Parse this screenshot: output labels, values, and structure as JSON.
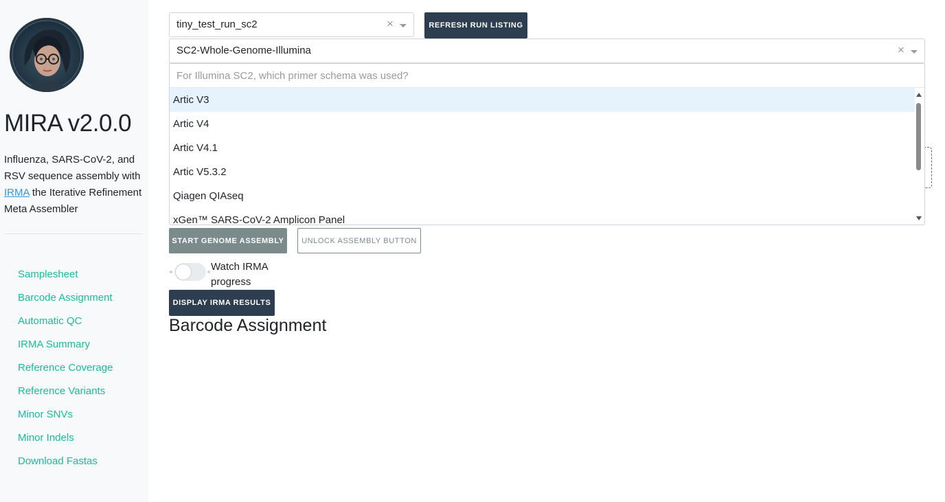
{
  "sidebar": {
    "title": "MIRA v2.0.0",
    "description_before": "Influenza, SARS-CoV-2, and RSV sequence assembly with ",
    "description_link": "IRMA",
    "description_after": " the Iterative Refinement Meta Assembler",
    "nav": [
      "Samplesheet",
      "Barcode Assignment",
      "Automatic QC",
      "IRMA Summary",
      "Reference Coverage",
      "Reference Variants",
      "Minor SNVs",
      "Minor Indels",
      "Download Fastas"
    ]
  },
  "run_select": {
    "value": "tiny_test_run_sc2",
    "clear": "×"
  },
  "refresh_button": "REFRESH RUN LISTING",
  "experiment_select": {
    "value": "SC2-Whole-Genome-Illumina",
    "clear": "×"
  },
  "primer_dropdown": {
    "placeholder": "For Illumina SC2, which primer schema was used?",
    "options": [
      "Artic V3",
      "Artic V4",
      "Artic V4.1",
      "Artic V5.3.2",
      "Qiagen QIAseq",
      "xGen™ SARS-CoV-2 Amplicon Panel"
    ],
    "highlighted_index": 0
  },
  "start_button": "START GENOME ASSEMBLY",
  "unlock_button": "UNLOCK ASSEMBLY BUTTON",
  "watch_toggle": {
    "label": "Watch IRMA progress",
    "on": false
  },
  "display_button": "DISPLAY IRMA RESULTS",
  "section_title": "Barcode Assignment",
  "colors": {
    "primary": "#2c3e50",
    "secondary": "#7b8a8b",
    "nav_link": "#18bc9c",
    "link": "#3498db",
    "highlight": "#e6f2fc"
  }
}
